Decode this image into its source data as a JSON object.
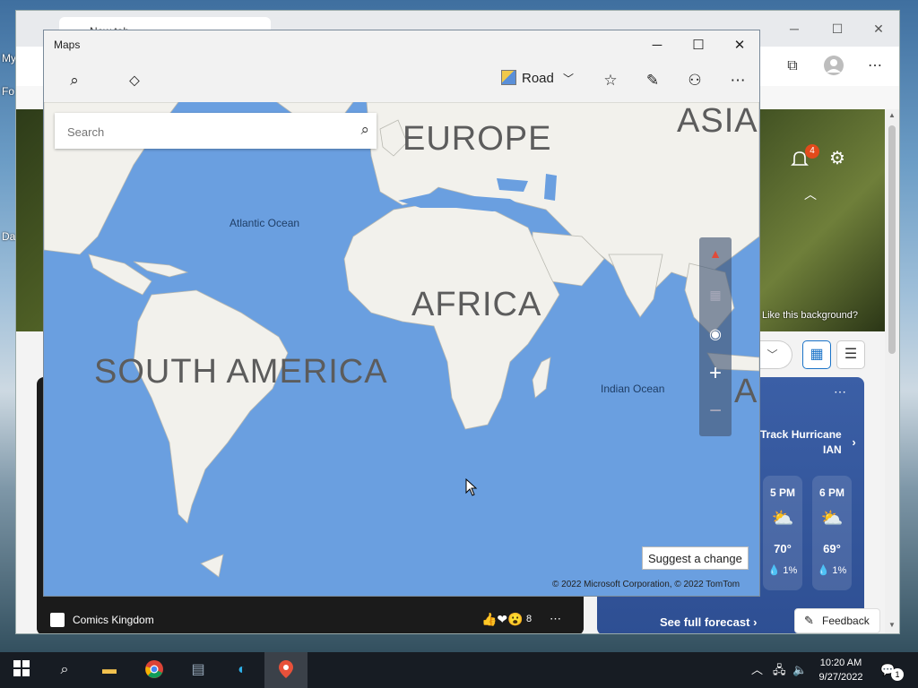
{
  "desktop": {
    "labels": [
      "My",
      "Fo",
      "Da"
    ]
  },
  "browser": {
    "tab_title": "New tab",
    "notification_count": "4",
    "background_prompt": "Like this background?"
  },
  "weather": {
    "track_line1": "Track Hurricane",
    "track_line2": "IAN",
    "hours": [
      {
        "time": "5 PM",
        "temp": "70°",
        "precip": "1%"
      },
      {
        "time": "6 PM",
        "temp": "69°",
        "precip": "1%"
      }
    ],
    "forecast_link": "See full forecast"
  },
  "comics": {
    "source": "Comics Kingdom",
    "reaction_count": "8"
  },
  "feedback_label": "Feedback",
  "maps": {
    "title": "Maps",
    "map_style": "Road",
    "search_placeholder": "Search",
    "labels": {
      "europe": "EUROPE",
      "asia": "ASIA",
      "africa": "AFRICA",
      "south_america": "SOUTH AMERICA",
      "atlantic": "Atlantic Ocean",
      "indian": "Indian Ocean",
      "au_partial": "AU"
    },
    "suggest_change": "Suggest a change",
    "copyright": "© 2022 Microsoft Corporation, © 2022 TomTom"
  },
  "taskbar": {
    "time": "10:20 AM",
    "date": "9/27/2022",
    "notification_count": "1"
  },
  "colors": {
    "ocean": "#6a9fe0",
    "land": "#f2f1ec",
    "accent": "#1a73c8",
    "weather_card": "#3b5fa6"
  }
}
